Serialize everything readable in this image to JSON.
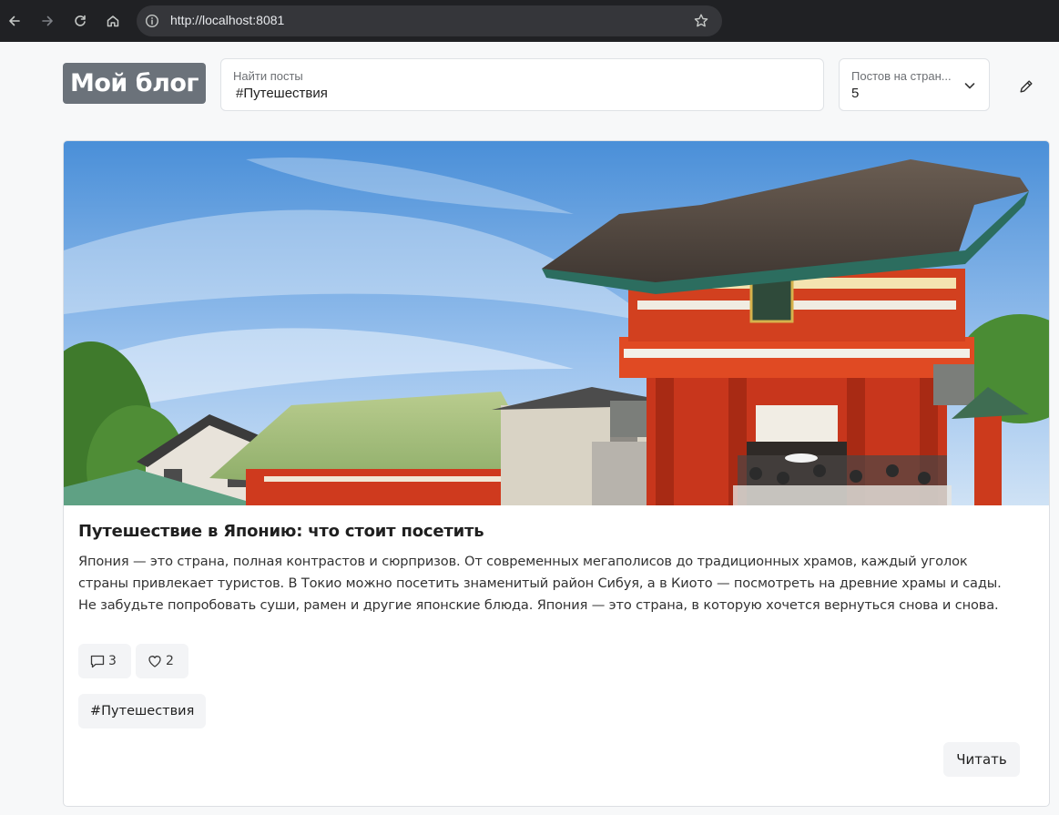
{
  "browser": {
    "url": "http://localhost:8081",
    "icons": [
      "back-icon",
      "forward-icon",
      "reload-icon",
      "home-icon",
      "site-info-icon",
      "bookmark-star-icon"
    ]
  },
  "header": {
    "logo": "Мой блог",
    "search": {
      "label": "Найти посты",
      "value": "#Путешествия"
    },
    "page_size": {
      "label": "Постов на стран...",
      "value": "5"
    },
    "edit_icon": "pencil-icon"
  },
  "post": {
    "image_description_icon": "photo-image",
    "title": "Путешествие в Японию: что стоит посетить",
    "text": "Япония — это страна, полная контрастов и сюрпризов. От современных мегаполисов до традиционных храмов, каждый уголок страны привлекает туристов. В Токио можно посетить знаменитый район Сибуя, а в Киото — посмотреть на древние храмы и сады. Не забудьте попробовать суши, рамен и другие японские блюда. Япония — это страна, в которую хочется вернуться снова и снова.",
    "comments_count": "3",
    "likes_count": "2",
    "tag": "#Путешествия",
    "read_label": "Читать"
  },
  "colors": {
    "browser_bg": "#202124",
    "logo_bg": "#6b727a",
    "chip_bg": "#f3f4f6",
    "page_bg": "#f7f8f9"
  }
}
